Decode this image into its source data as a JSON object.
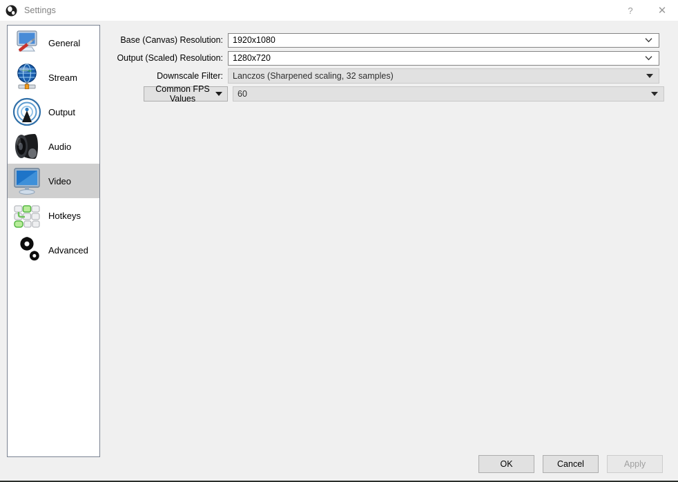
{
  "window": {
    "title": "Settings",
    "logo_icon": "obs-logo-icon",
    "help_label": "?",
    "close_label": "✕"
  },
  "sidebar": {
    "items": [
      {
        "label": "General",
        "icon": "monitor-screwdriver-icon",
        "selected": false
      },
      {
        "label": "Stream",
        "icon": "globe-broadcast-icon",
        "selected": false
      },
      {
        "label": "Output",
        "icon": "antenna-signal-icon",
        "selected": false
      },
      {
        "label": "Audio",
        "icon": "speaker-icon",
        "selected": false
      },
      {
        "label": "Video",
        "icon": "display-monitor-icon",
        "selected": true
      },
      {
        "label": "Hotkeys",
        "icon": "keyboard-keys-icon",
        "selected": false
      },
      {
        "label": "Advanced",
        "icon": "gears-icon",
        "selected": false
      }
    ]
  },
  "video_settings": {
    "base_resolution": {
      "label": "Base (Canvas) Resolution:",
      "value": "1920x1080",
      "enabled": true
    },
    "output_resolution": {
      "label": "Output (Scaled) Resolution:",
      "value": "1280x720",
      "enabled": true
    },
    "downscale_filter": {
      "label": "Downscale Filter:",
      "value": "Lanczos (Sharpened scaling, 32 samples)",
      "enabled": false
    },
    "fps_type": {
      "label": "Common FPS Values",
      "value": "60",
      "enabled": false
    }
  },
  "footer": {
    "ok_label": "OK",
    "cancel_label": "Cancel",
    "apply_label": "Apply",
    "apply_enabled": false
  },
  "colors": {
    "dialog_background": "#f0f0f0",
    "titlebar_background": "#ffffff",
    "selection_highlight": "#cfcfcf",
    "field_border": "#848484",
    "disabled_text": "#a0a0a0"
  }
}
